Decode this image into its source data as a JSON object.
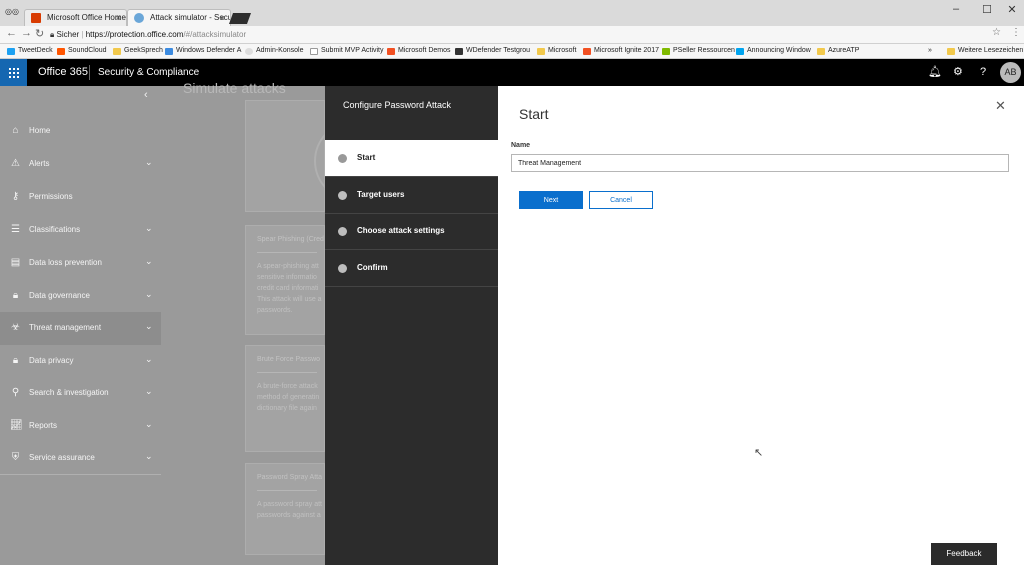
{
  "browser": {
    "tabs": [
      {
        "title": "Microsoft Office Home",
        "close": "×"
      },
      {
        "title": "Attack simulator - Secur",
        "close": "×"
      }
    ],
    "security_label": "Sicher",
    "url_domain": "https://protection.office.com",
    "url_path": "/#/attacksimulator",
    "bookmarks": [
      "TweetDeck",
      "SoundCloud",
      "GeekSprech",
      "Windows Defender A",
      "Admin-Konsole",
      "Submit MVP Activity",
      "Microsoft Demos",
      "WDefender Testgrou",
      "Microsoft",
      "Microsoft Ignite 2017",
      "PSeller Ressourcen",
      "Announcing Window",
      "AzureATP"
    ],
    "bookmarks_more": "»",
    "other_bookmarks": "Weitere Lesezeichen"
  },
  "header": {
    "brand": "Office 365",
    "app": "Security & Compliance",
    "help": "?",
    "avatar_initials": "AB"
  },
  "nav": {
    "collapse": "‹",
    "items": [
      {
        "label": "Home",
        "icon": "home-icon",
        "expandable": false
      },
      {
        "label": "Alerts",
        "icon": "warning-icon",
        "expandable": true
      },
      {
        "label": "Permissions",
        "icon": "key-icon",
        "expandable": false
      },
      {
        "label": "Classifications",
        "icon": "list-icon",
        "expandable": true
      },
      {
        "label": "Data loss prevention",
        "icon": "document-icon",
        "expandable": true
      },
      {
        "label": "Data governance",
        "icon": "lock-icon",
        "expandable": true
      },
      {
        "label": "Threat management",
        "icon": "biohazard-icon",
        "expandable": true,
        "selected": true
      },
      {
        "label": "Data privacy",
        "icon": "lock-icon",
        "expandable": true
      },
      {
        "label": "Search & investigation",
        "icon": "search-icon",
        "expandable": true
      },
      {
        "label": "Reports",
        "icon": "chart-icon",
        "expandable": true
      },
      {
        "label": "Service assurance",
        "icon": "badge-icon",
        "expandable": true
      }
    ]
  },
  "background_page": {
    "title": "Simulate attacks",
    "cards": [
      {
        "title": "Spear Phishing (Cred",
        "desc": "A spear-phishing att\nsensitive informatio\ncredit card informati\nThis attack will use a\npasswords."
      },
      {
        "title": "Brute Force Passwo",
        "desc": "A brute-force attack\nmethod of generatin\ndictionary file again"
      },
      {
        "title": "Password Spray Atta",
        "desc": "A password spray att\npasswords against a"
      }
    ]
  },
  "wizard": {
    "title": "Configure Password Attack",
    "steps": [
      "Start",
      "Target users",
      "Choose attack settings",
      "Confirm"
    ],
    "current_step": 0,
    "heading": "Start",
    "close": "✕",
    "name_label": "Name",
    "name_value": "Threat Management",
    "next_label": "Next",
    "cancel_label": "Cancel"
  },
  "feedback": "Feedback"
}
